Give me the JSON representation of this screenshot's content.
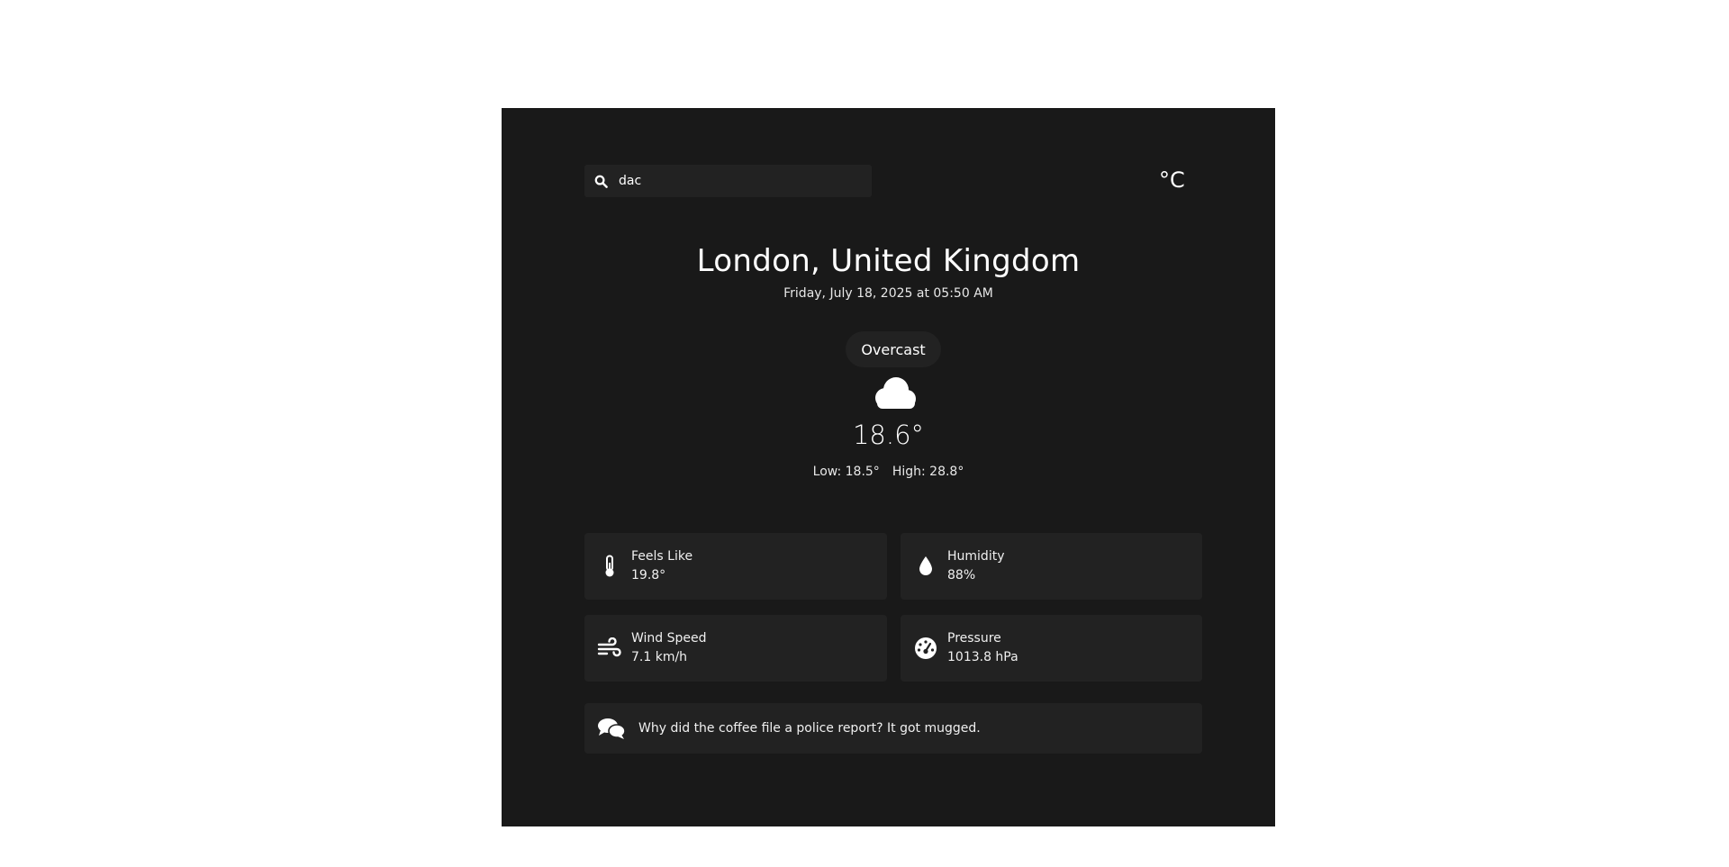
{
  "search": {
    "value": "dac",
    "icon": "search-icon"
  },
  "unit_toggle": {
    "label": "°C"
  },
  "location": {
    "title": "London, United Kingdom",
    "datetime": "Friday, July 18, 2025 at 05:50 AM"
  },
  "current": {
    "condition": "Overcast",
    "icon": "cloud-icon",
    "temperature": "18.6°",
    "low": "Low: 18.5°",
    "high": "High: 28.8°"
  },
  "details": [
    {
      "label": "Feels Like",
      "value": "19.8°",
      "icon": "thermometer-icon"
    },
    {
      "label": "Humidity",
      "value": "88%",
      "icon": "droplet-icon"
    },
    {
      "label": "Wind Speed",
      "value": "7.1 km/h",
      "icon": "wind-icon"
    },
    {
      "label": "Pressure",
      "value": "1013.8 hPa",
      "icon": "gauge-icon"
    }
  ],
  "joke": {
    "text": "Why did the coffee file a police report? It got mugged.",
    "icon": "chat-bubbles-icon"
  },
  "colors": {
    "card_background": "#191919",
    "tile_background": "#222222",
    "text": "#ffffff"
  }
}
